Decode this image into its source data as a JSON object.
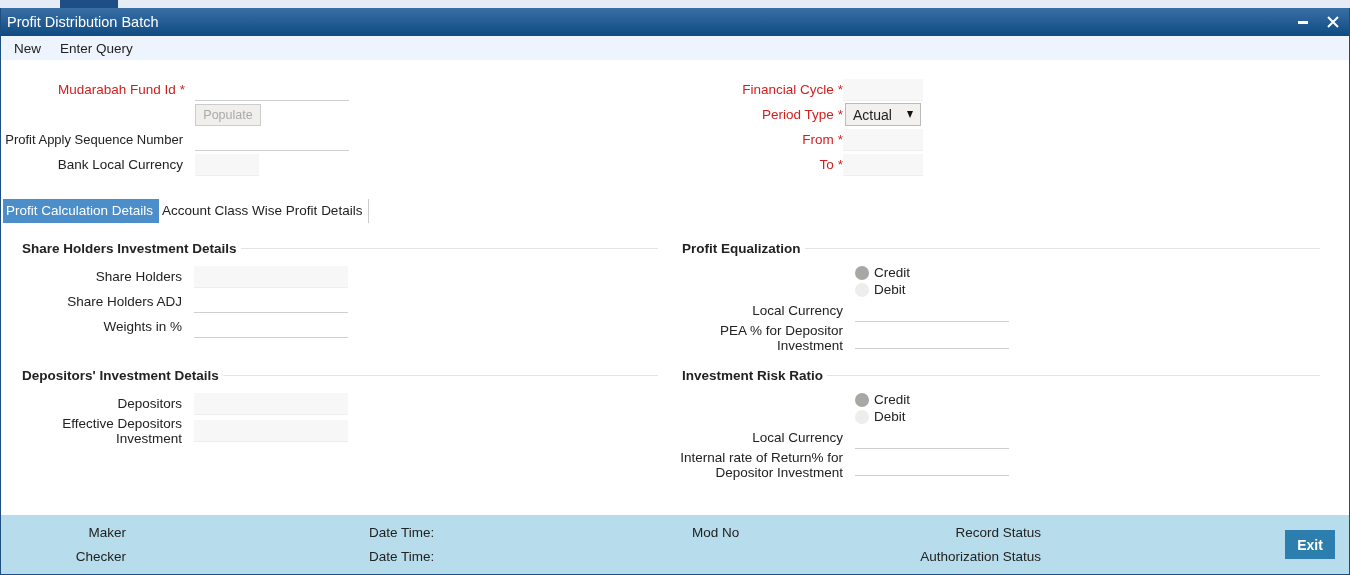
{
  "window": {
    "title": "Profit Distribution Batch"
  },
  "toolbar": [
    "New",
    "Enter Query"
  ],
  "header": {
    "left": [
      {
        "kind": "text",
        "label": "Mudarabah Fund Id",
        "required_mark": "*"
      },
      {
        "kind": "button",
        "label": "Populate",
        "disabled": true
      },
      {
        "kind": "text",
        "label": "Profit Apply Sequence Number"
      },
      {
        "kind": "readonly",
        "label": "Bank Local Currency"
      }
    ],
    "right": [
      {
        "kind": "readonly",
        "label": "Financial Cycle",
        "required_mark": "*"
      },
      {
        "kind": "select",
        "label": "Period Type",
        "required_mark": "*",
        "value": "Actual"
      },
      {
        "kind": "readonly",
        "label": "From",
        "required_mark": "*"
      },
      {
        "kind": "readonly",
        "label": "To",
        "required_mark": "*"
      }
    ]
  },
  "tabs": [
    {
      "label": "Profit Calculation Details",
      "selected": true
    },
    {
      "label": "Account Class Wise Profit Details",
      "selected": false
    }
  ],
  "sections": [
    {
      "title": "Share Holders Investment Details",
      "rows": [
        {
          "kind": "readonly",
          "label": "Share Holders"
        },
        {
          "kind": "text",
          "label": "Share Holders ADJ"
        },
        {
          "kind": "text",
          "label": "Weights in %"
        }
      ]
    },
    {
      "title": "Profit Equalization",
      "rows": [
        {
          "kind": "radio",
          "options": [
            {
              "label": "Credit",
              "selected": true
            },
            {
              "label": "Debit",
              "selected": false
            }
          ]
        },
        {
          "kind": "text",
          "label": "Local Currency"
        },
        {
          "kind": "text",
          "label": "PEA % for Depositor Investment"
        }
      ]
    },
    {
      "title": "Depositors' Investment Details",
      "rows": [
        {
          "kind": "readonly",
          "label": "Depositors"
        },
        {
          "kind": "readonly",
          "label": "Effective Depositors Investment"
        }
      ]
    },
    {
      "title": "Investment Risk Ratio",
      "rows": [
        {
          "kind": "radio",
          "options": [
            {
              "label": "Credit",
              "selected": true
            },
            {
              "label": "Debit",
              "selected": false
            }
          ]
        },
        {
          "kind": "text",
          "label": "Local Currency"
        },
        {
          "kind": "text",
          "label": "Internal rate of Return% for Depositor Investment"
        }
      ]
    }
  ],
  "footer": {
    "rows": [
      {
        "user": "Maker",
        "date_time": "Date Time:",
        "mod_no": "Mod No",
        "status": "Record Status"
      },
      {
        "user": "Checker",
        "date_time": "Date Time:",
        "status": "Authorization Status"
      }
    ],
    "exit_button": "Exit"
  }
}
